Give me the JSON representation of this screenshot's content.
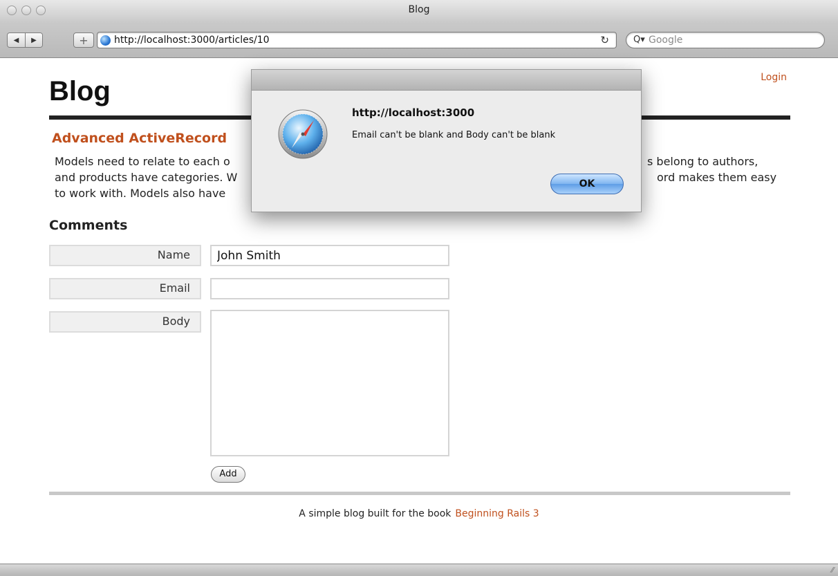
{
  "window": {
    "title": "Blog",
    "url": "http://localhost:3000/articles/10",
    "search_placeholder": "Google"
  },
  "page": {
    "login_label": "Login",
    "blog_title": "Blog",
    "article": {
      "title": "Advanced ActiveRecord",
      "body_visible_fragments": [
        "Models need to relate to each o",
        "and products have categories. W",
        "to work with. Models also have",
        "s belong to authors,",
        "ord makes them easy"
      ]
    },
    "comments": {
      "heading": "Comments",
      "name_label": "Name",
      "name_value": "John Smith",
      "email_label": "Email",
      "email_value": "",
      "body_label": "Body",
      "body_value": "",
      "add_label": "Add"
    },
    "footer": {
      "text": "A simple blog built for the book",
      "link_label": "Beginning Rails 3"
    }
  },
  "alert": {
    "origin": "http://localhost:3000",
    "message": "Email can't be blank and Body can't be blank",
    "ok_label": "OK"
  },
  "colors": {
    "link_accent": "#c0501d",
    "header_rule": "#222222",
    "ok_button": "#7fb5f0"
  },
  "icons": {
    "back": "back-arrow-icon",
    "forward": "forward-arrow-icon",
    "add_bookmark": "plus-icon",
    "site": "globe-icon",
    "reload": "reload-icon",
    "search": "search-icon",
    "alert": "safari-compass-icon"
  }
}
